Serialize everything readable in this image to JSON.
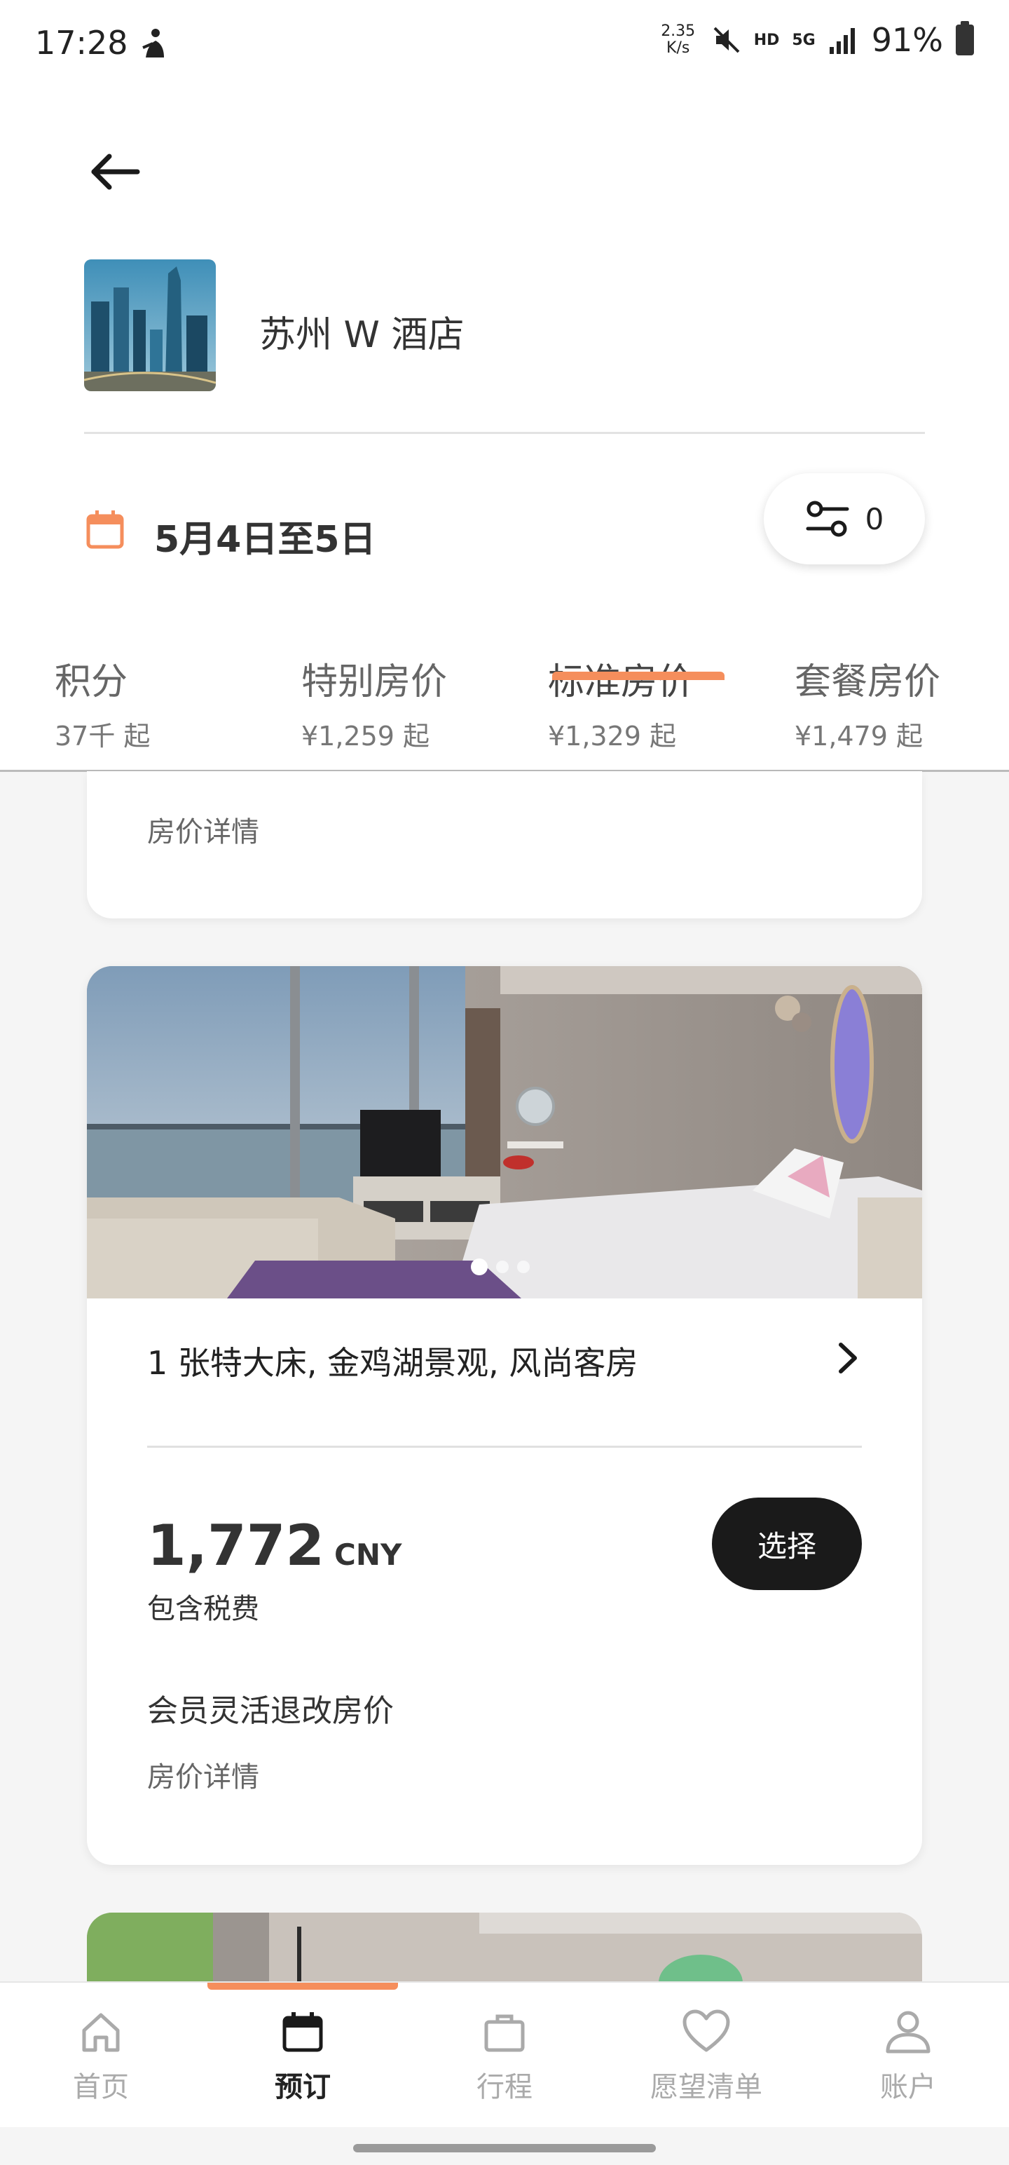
{
  "status_bar": {
    "time": "17:28",
    "net_speed_value": "2.35",
    "net_speed_unit": "K/s",
    "hd_label": "HD",
    "network_label": "5G",
    "battery": "91%"
  },
  "header": {
    "hotel_name": "苏州 W 酒店",
    "dates": "5月4日至5日",
    "filter_count": "0"
  },
  "rate_tabs": [
    {
      "title": "积分",
      "price": "37千 起"
    },
    {
      "title": "特别房价",
      "price": "¥1,259 起"
    },
    {
      "title": "标准房价",
      "price": "¥1,329 起"
    },
    {
      "title": "套餐房价",
      "price": "¥1,479 起"
    }
  ],
  "active_tab_index": 2,
  "partial_card": {
    "details_link": "房价详情"
  },
  "room_card": {
    "photo_count": 3,
    "photo_index": 1,
    "title": "1 张特大床, 金鸡湖景观, 风尚客房",
    "price": "1,772",
    "currency": "CNY",
    "tax_note": "包含税费",
    "select_label": "选择",
    "rate_name": "会员灵活退改房价",
    "details_link": "房价详情"
  },
  "bottom_nav": [
    {
      "label": "首页",
      "icon": "home-icon"
    },
    {
      "label": "预订",
      "icon": "calendar-icon"
    },
    {
      "label": "行程",
      "icon": "briefcase-icon"
    },
    {
      "label": "愿望清单",
      "icon": "heart-icon"
    },
    {
      "label": "账户",
      "icon": "person-icon"
    }
  ],
  "active_nav_index": 1,
  "colors": {
    "accent": "#f58e5c",
    "button_dark": "#1a1a1a",
    "background": "#f5f5f5"
  }
}
